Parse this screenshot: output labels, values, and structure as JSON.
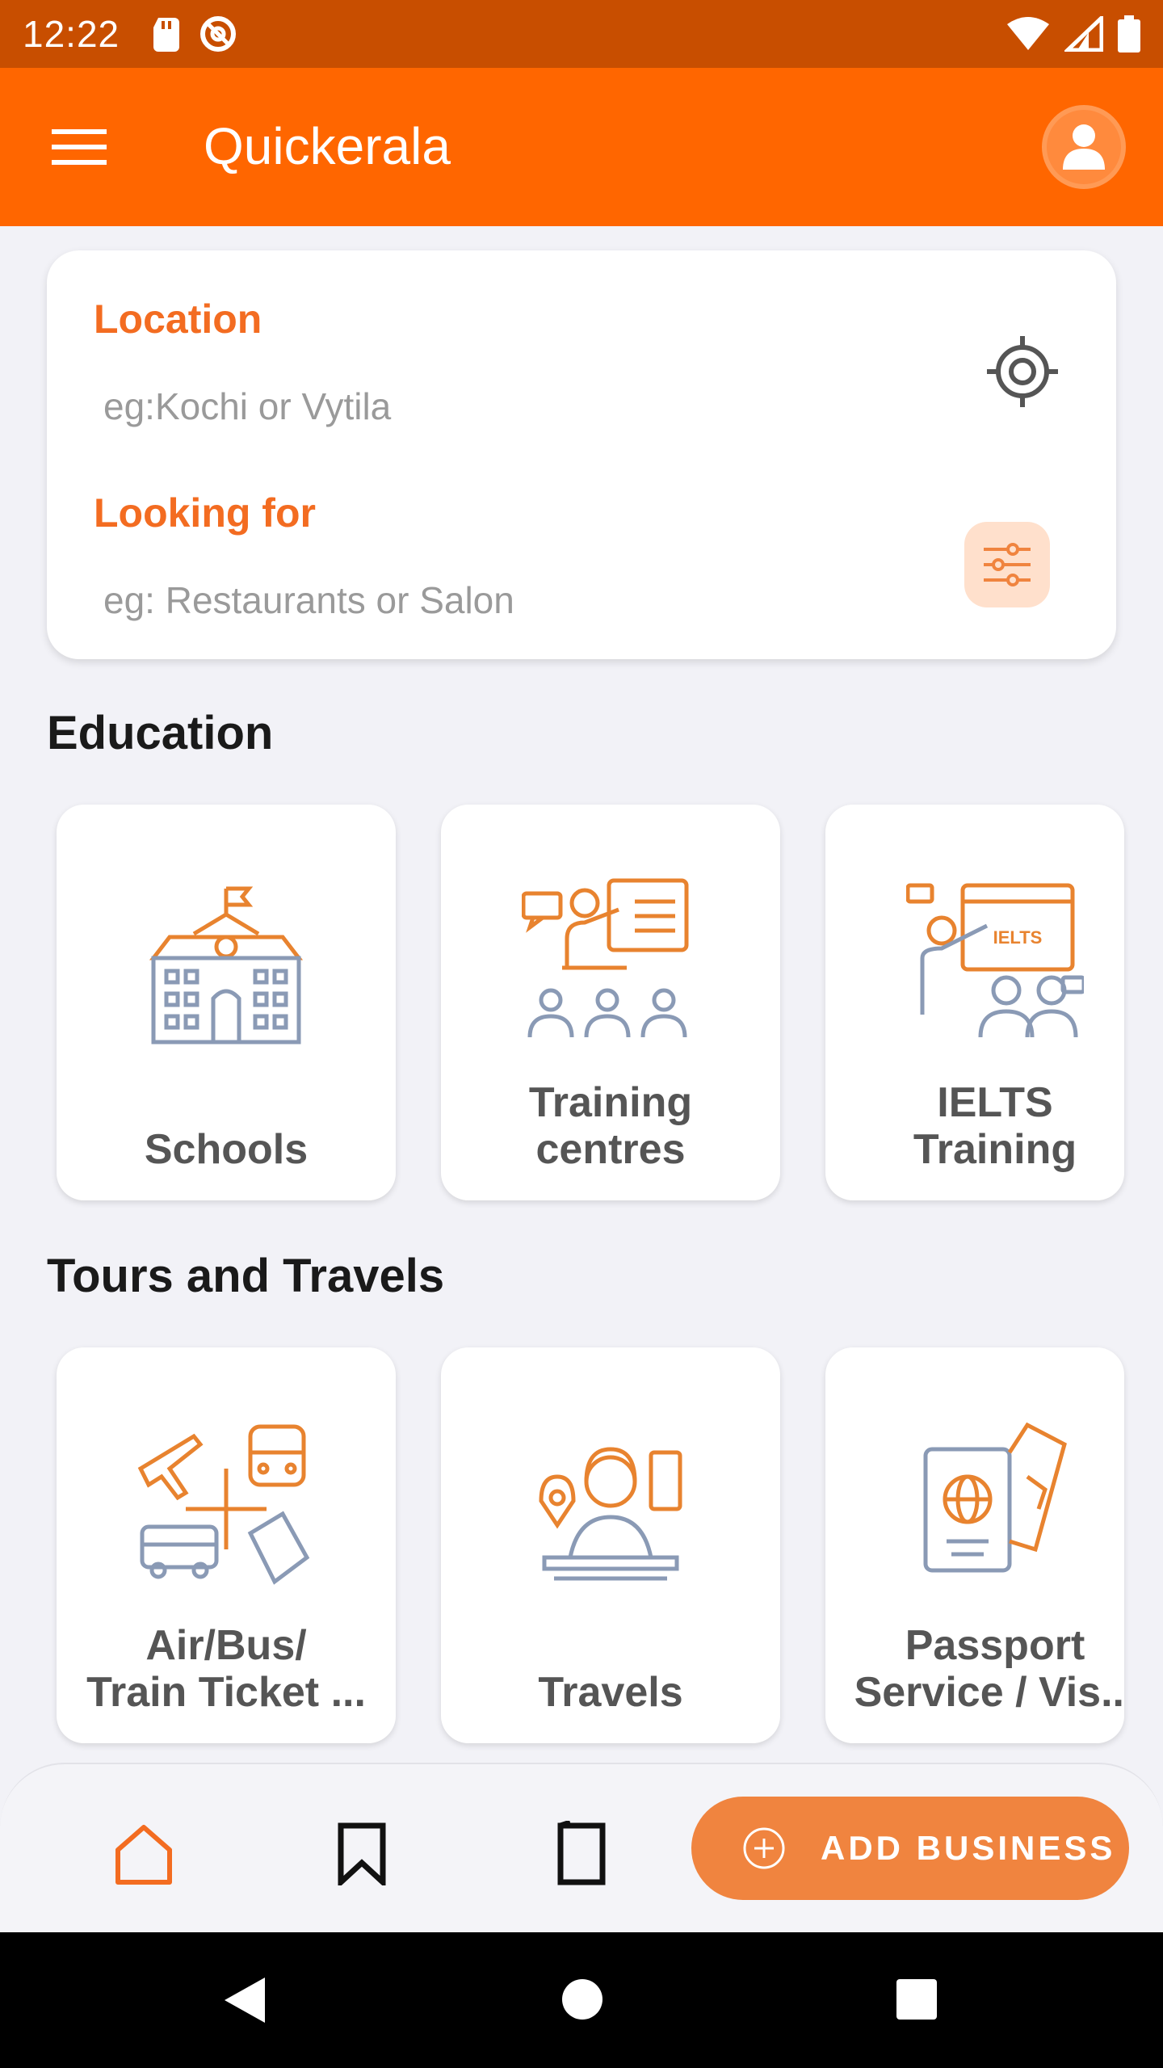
{
  "status_bar": {
    "time": "12:22"
  },
  "app_bar": {
    "title": "Quickerala"
  },
  "search": {
    "location_label": "Location",
    "location_placeholder": "eg:Kochi or Vytila",
    "looking_for_label": "Looking for",
    "looking_for_placeholder": "eg: Restaurants or Salon"
  },
  "sections": [
    {
      "title": "Education",
      "cards": [
        {
          "label": "Schools",
          "icon": "school-building-icon"
        },
        {
          "label": "Training\ncentres",
          "icon": "training-presentation-icon"
        },
        {
          "label": "IELTS\nTraining",
          "icon": "ielts-class-icon",
          "badge": "IELTS"
        }
      ]
    },
    {
      "title": "Tours and Travels",
      "cards": [
        {
          "label": "Air/Bus/\nTrain Ticket ...",
          "icon": "transport-tickets-icon"
        },
        {
          "label": "Travels",
          "icon": "travel-agent-icon"
        },
        {
          "label": "Passport\nService / Vis...",
          "icon": "passport-icon"
        }
      ]
    }
  ],
  "bottom_nav": {
    "add_business_label": "ADD BUSINESS",
    "items": [
      "home-icon",
      "bookmark-icon",
      "device-icon"
    ]
  },
  "colors": {
    "brand": "#FF6600",
    "status_bar": "#C84E00",
    "accent_text": "#F36C21",
    "button": "#F0843F"
  }
}
